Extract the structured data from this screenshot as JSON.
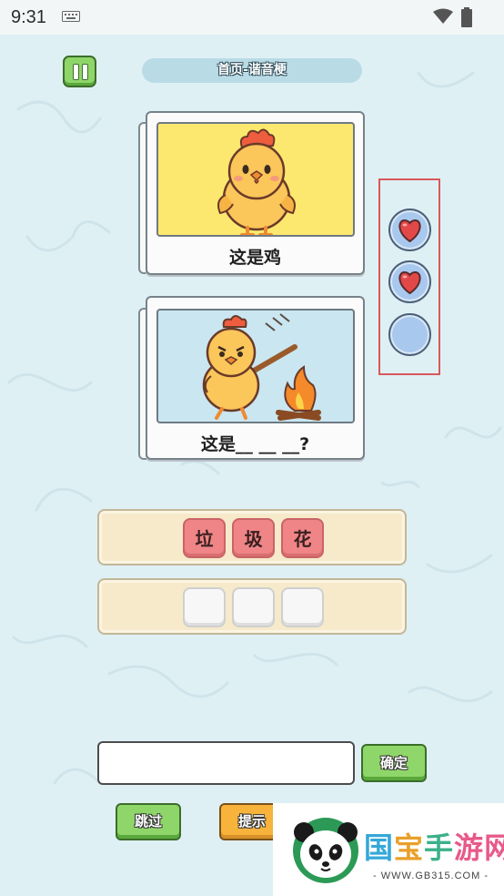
{
  "status_bar": {
    "time": "9:31"
  },
  "header": {
    "title": "首页-谐音梗"
  },
  "cards": [
    {
      "caption": "这是鸡"
    },
    {
      "caption": "这是__ __ __?"
    }
  ],
  "lives": {
    "total": 3,
    "remaining": 2
  },
  "letter_tiles": [
    "垃",
    "圾",
    "花"
  ],
  "answer_slots": [
    "",
    "",
    ""
  ],
  "answer_input": {
    "value": "",
    "placeholder": ""
  },
  "buttons": {
    "confirm": "确定",
    "skip": "跳过",
    "hint": "提示",
    "third": ""
  },
  "watermark": {
    "brand": "国宝手游网",
    "url": "- WWW.GB315.COM -"
  },
  "colors": {
    "background": "#dff0f5",
    "green_button": "#8fd66a",
    "orange_button": "#f7b33c",
    "tile_red": "#ef8587",
    "lives_frame": "#d9585a"
  }
}
